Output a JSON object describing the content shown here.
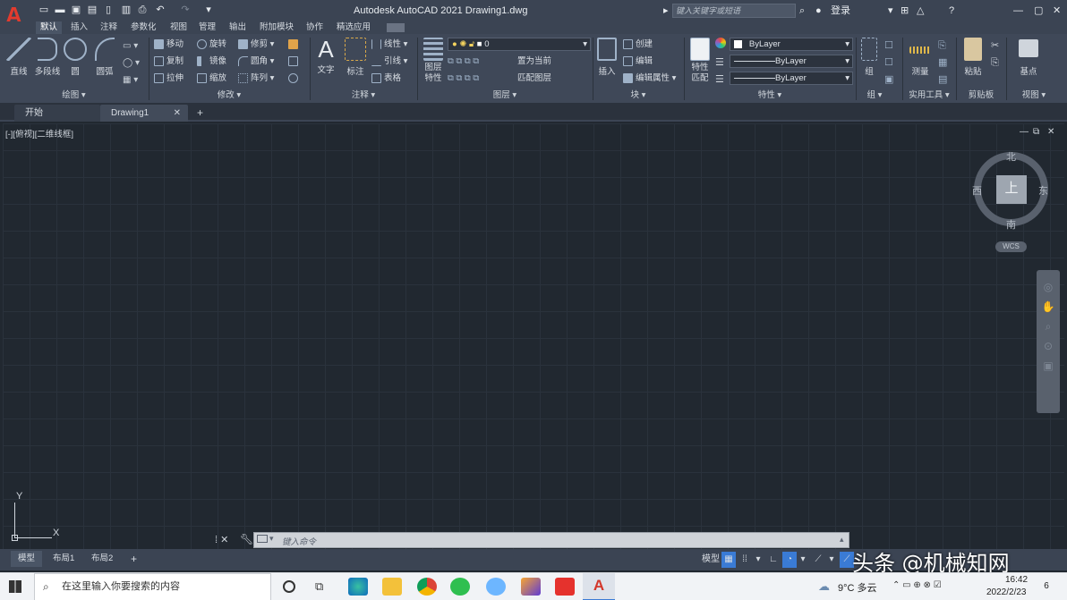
{
  "titlebar": {
    "app_title": "Autodesk AutoCAD 2021   Drawing1.dwg",
    "search_placeholder": "键入关键字或短语",
    "login_label": "登录",
    "logo_letter": "A",
    "brand_color": "#e23b2e"
  },
  "ribbon_tabs": [
    "默认",
    "插入",
    "注释",
    "参数化",
    "视图",
    "管理",
    "输出",
    "附加模块",
    "协作",
    "精选应用"
  ],
  "draw_panel": {
    "line": "直线",
    "polyline": "多段线",
    "circle": "圆",
    "arc": "圆弧",
    "label": "绘图 ▾"
  },
  "modify_panel": {
    "move": "移动",
    "rotate": "旋转",
    "trim": "修剪",
    "copy": "复制",
    "mirror": "镜像",
    "fillet": "圆角",
    "stretch": "拉伸",
    "scale": "缩放",
    "array": "阵列",
    "label": "修改 ▾"
  },
  "annotation_panel": {
    "text": "文字",
    "dimension": "标注",
    "linear": "线性",
    "leader": "引线",
    "table": "表格",
    "label": "注释 ▾"
  },
  "layers_panel": {
    "layer_props": "图层特性",
    "current_layer": "0",
    "set_current": "置为当前",
    "match_layer": "匹配图层",
    "label": "图层 ▾"
  },
  "block_panel": {
    "insert": "插入",
    "create": "创建",
    "edit": "编辑",
    "edit_attr": "编辑属性 ▾",
    "label": "块 ▾"
  },
  "properties_panel": {
    "match": "特性匹配",
    "color": "ByLayer",
    "linetype": "ByLayer",
    "lineweight": "ByLayer",
    "label": "特性 ▾"
  },
  "groups_panel": {
    "group": "组",
    "label": "组 ▾"
  },
  "utilities_panel": {
    "measure": "测量",
    "label": "实用工具 ▾"
  },
  "clipboard_panel": {
    "paste": "粘贴",
    "label": "剪贴板"
  },
  "view_panel": {
    "base": "基点",
    "label": "视图 ▾"
  },
  "doc_tabs": [
    "开始",
    "Drawing1"
  ],
  "viewport": {
    "view_label": "[-][俯视][二维线框]",
    "cube_top": "上",
    "north": "北",
    "south": "南",
    "east": "东",
    "west": "西",
    "wcs": "WCS",
    "axis_x": "X",
    "axis_y": "Y"
  },
  "command": {
    "placeholder": "键入命令"
  },
  "layout_tabs": [
    "模型",
    "布局1",
    "布局2"
  ],
  "status": {
    "model": "模型"
  },
  "taskbar": {
    "search_placeholder": "在这里输入你要搜索的内容",
    "weather": "9°C 多云",
    "date": "2022/2/23",
    "time": "16:42",
    "notifications": "6"
  },
  "watermark": "头条 @机械知网"
}
